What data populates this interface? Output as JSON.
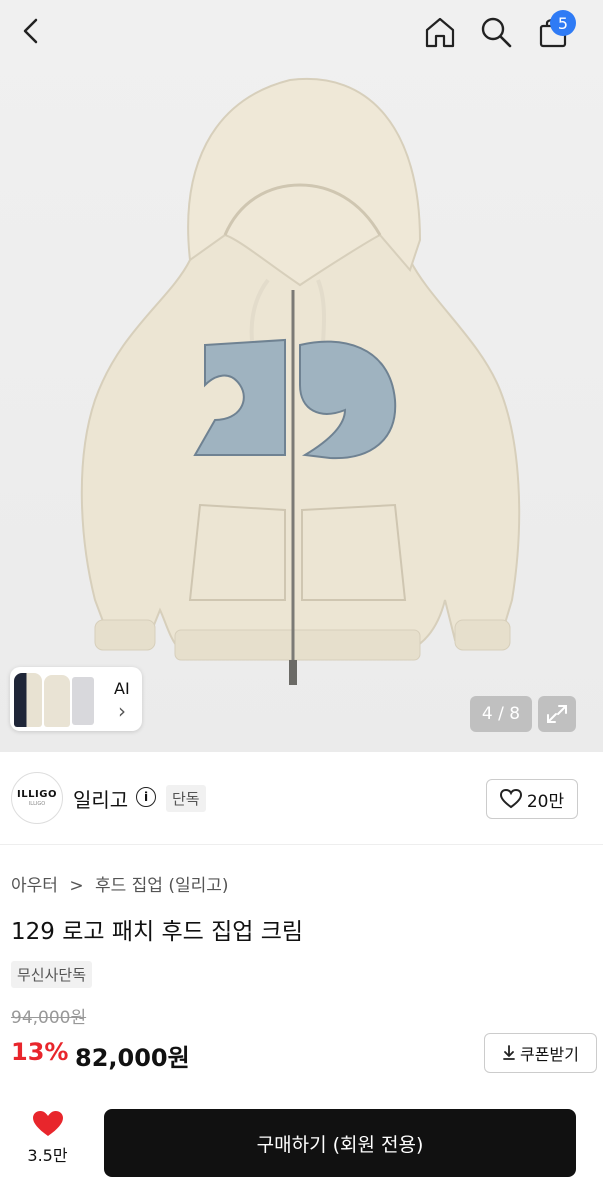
{
  "header": {
    "cart_count": "5"
  },
  "gallery": {
    "ai_label": "AI",
    "ai_chevron": "›",
    "counter": "4 / 8"
  },
  "brand": {
    "logo_text": "ILLIGO",
    "logo_sub": "ILLIGO",
    "name": "일리고",
    "exclusive_tag": "단독",
    "likes": "20만"
  },
  "breadcrumb": {
    "category": "아우터",
    "separator": ">",
    "sub": "후드 집업 (일리고)"
  },
  "product": {
    "title": "129 로고 패치 후드 집업 크림",
    "exclusive_tag": "무신사단독",
    "original_price": "94,000원",
    "discount": "13%",
    "price": "82,000원",
    "coupon_label": "쿠폰받기"
  },
  "bottom": {
    "like_count": "3.5만",
    "buy_label": "구매하기 (회원 전용)"
  },
  "colors": {
    "accent": "#e8262c",
    "badge": "#2f7bf5",
    "button": "#111111",
    "hoodie": "#ece5d3",
    "patch": "#9fb3c0"
  },
  "icons": [
    "back-icon",
    "home-icon",
    "search-icon",
    "cart-icon",
    "chevron-right-icon",
    "expand-icon",
    "info-icon",
    "heart-outline-icon",
    "download-icon",
    "heart-filled-icon"
  ]
}
